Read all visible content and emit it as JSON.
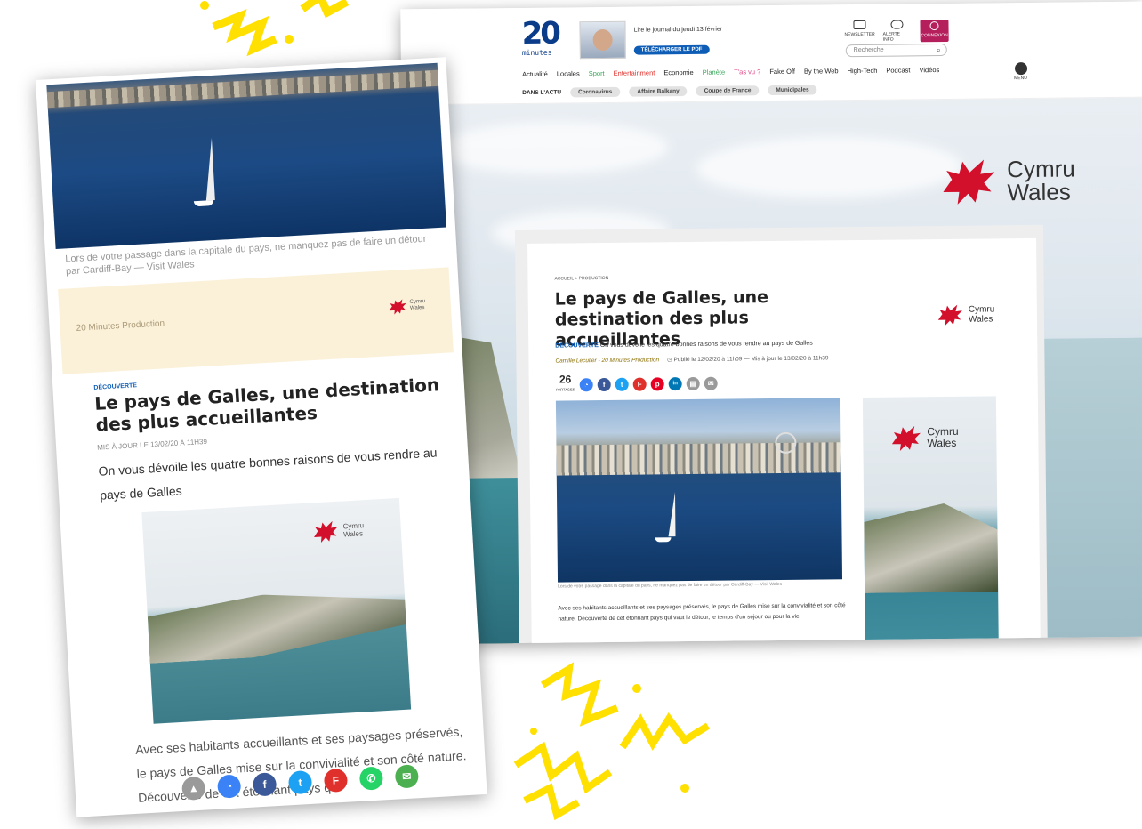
{
  "colors": {
    "brand_blue": "#0d5cb6",
    "wales_red": "#d3102b",
    "deco_yellow": "#ffe000",
    "connexion_magenta": "#b51f5c"
  },
  "desktop": {
    "logo": {
      "number": "20",
      "word": "minutes"
    },
    "journal": {
      "text": "Lire le journal du jeudi 13 février",
      "button": "TÉLÉCHARGER LE PDF"
    },
    "top_icons": [
      {
        "label": "NEWSLETTER",
        "icon": "envelope-icon"
      },
      {
        "label": "ALERTE INFO",
        "icon": "toggle-icon"
      },
      {
        "label": "CONNEXION",
        "icon": "user-icon"
      }
    ],
    "search_placeholder": "Recherche",
    "nav": [
      {
        "label": "Actualité",
        "color": "#222222"
      },
      {
        "label": "Locales",
        "color": "#222222"
      },
      {
        "label": "Sport",
        "color": "#3aa85a"
      },
      {
        "label": "Entertainment",
        "color": "#e0302b"
      },
      {
        "label": "Economie",
        "color": "#222222"
      },
      {
        "label": "Planète",
        "color": "#3aa85a"
      },
      {
        "label": "T'as vu ?",
        "color": "#e04b8a"
      },
      {
        "label": "Fake Off",
        "color": "#222222"
      },
      {
        "label": "By the Web",
        "color": "#222222"
      },
      {
        "label": "High-Tech",
        "color": "#222222"
      },
      {
        "label": "Podcast",
        "color": "#222222"
      },
      {
        "label": "Vidéos",
        "color": "#222222"
      }
    ],
    "menu_label": "MENU",
    "dans_actu_label": "DANS L'ACTU",
    "actu_chips": [
      "Coronavirus",
      "Affaire Balkany",
      "Coupe de France",
      "Municipales"
    ],
    "brand": {
      "line1": "Cymru",
      "line2": "Wales"
    },
    "article": {
      "breadcrumb": "ACCUEIL > PRODUCTION",
      "title": "Le pays de Galles, une destination des plus accueillantes",
      "kicker": "DÉCOUVERTE",
      "chapo": "On vous dévoile les quatre bonnes raisons de vous rendre au pays de Galles",
      "author": "Camille Leculier - 20 Minutes Production",
      "meta": "Publié le 12/02/20 à 11h09 — Mis à jour le 13/02/20 à 11h39",
      "share_count": "26",
      "share_label": "PARTAGES",
      "caption": "Lors de votre passage dans la capitale du pays, ne manquez pas de faire un détour par Cardiff-Bay — Visit Wales",
      "body": "Avec ses habitants accueillants et ses paysages préservés, le pays de Galles mise sur la convivialité et son côté nature. Découverte de cet étonnant pays qui vaut le détour, le temps d'un séjour ou pour la vie."
    }
  },
  "mobile": {
    "caption": "Lors de votre passage dans la capitale du pays, ne manquez pas de faire un détour par Cardiff-Bay — Visit Wales",
    "ad_label": "20 Minutes Production",
    "kicker": "DÉCOUVERTE",
    "title": "Le pays de Galles, une destination des plus accueillantes",
    "date": "MIS À JOUR LE 13/02/20 À 11H39",
    "chapo": "On vous dévoile les quatre bonnes raisons de vous rendre au pays de Galles",
    "body": "Avec ses habitants accueillants et ses paysages préservés, le pays de Galles mise sur la convivialité et son côté nature. Découverte de cet étonnant pays qui",
    "brand": {
      "line1": "Cymru",
      "line2": "Wales"
    }
  }
}
